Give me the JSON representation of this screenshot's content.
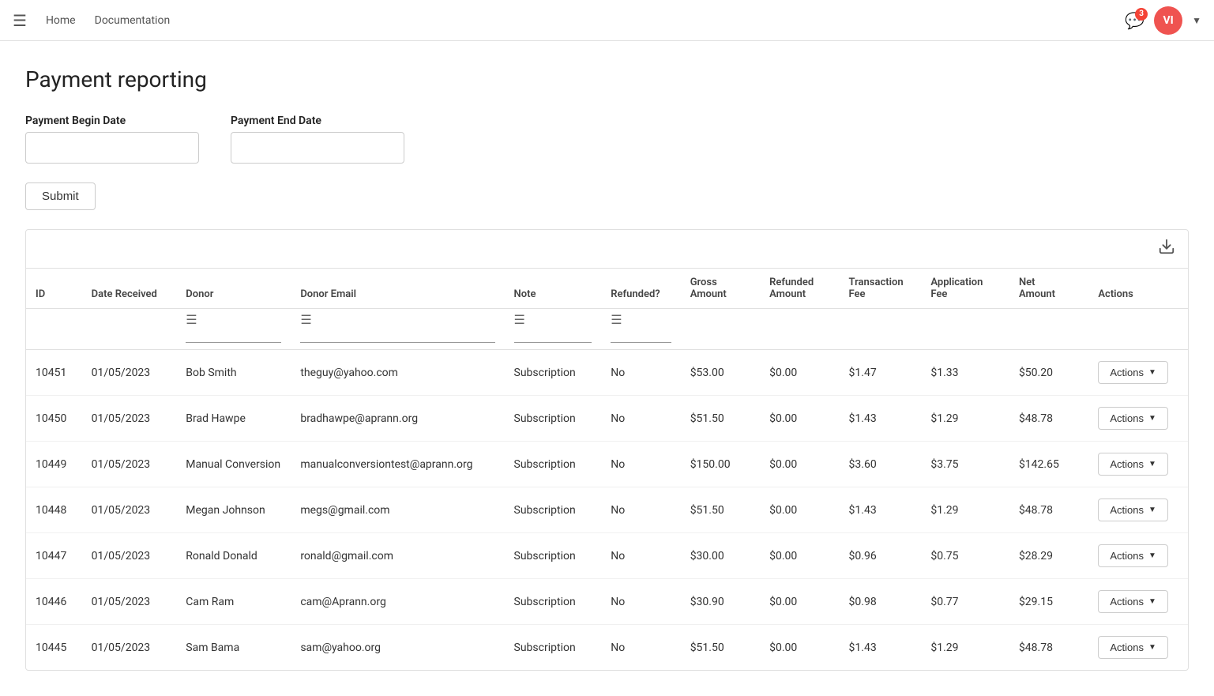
{
  "navbar": {
    "home_label": "Home",
    "documentation_label": "Documentation",
    "notification_count": "3",
    "avatar_initials": "VI"
  },
  "page": {
    "title": "Payment reporting"
  },
  "form": {
    "begin_date_label": "Payment Begin Date",
    "end_date_label": "Payment End Date",
    "begin_date_placeholder": "",
    "end_date_placeholder": "",
    "submit_label": "Submit"
  },
  "table": {
    "download_tooltip": "Download",
    "columns": {
      "id": "ID",
      "date_received": "Date Received",
      "donor": "Donor",
      "donor_email": "Donor Email",
      "note": "Note",
      "refunded": "Refunded?",
      "gross_amount": "Gross Amount",
      "refunded_amount": "Refunded Amount",
      "transaction_fee": "Transaction Fee",
      "application_fee": "Application Fee",
      "net_amount": "Net Amount",
      "actions": "Actions"
    },
    "rows": [
      {
        "id": "10451",
        "date": "01/05/2023",
        "donor": "Bob Smith",
        "email": "theguy@yahoo.com",
        "note": "Subscription",
        "refunded": "No",
        "gross": "$53.00",
        "refunded_amt": "$0.00",
        "tx_fee": "$1.47",
        "app_fee": "$1.33",
        "net": "$50.20"
      },
      {
        "id": "10450",
        "date": "01/05/2023",
        "donor": "Brad Hawpe",
        "email": "bradhawpe@aprann.org",
        "note": "Subscription",
        "refunded": "No",
        "gross": "$51.50",
        "refunded_amt": "$0.00",
        "tx_fee": "$1.43",
        "app_fee": "$1.29",
        "net": "$48.78"
      },
      {
        "id": "10449",
        "date": "01/05/2023",
        "donor": "Manual Conversion",
        "email": "manualconversiontest@aprann.org",
        "note": "Subscription",
        "refunded": "No",
        "gross": "$150.00",
        "refunded_amt": "$0.00",
        "tx_fee": "$3.60",
        "app_fee": "$3.75",
        "net": "$142.65"
      },
      {
        "id": "10448",
        "date": "01/05/2023",
        "donor": "Megan Johnson",
        "email": "megs@gmail.com",
        "note": "Subscription",
        "refunded": "No",
        "gross": "$51.50",
        "refunded_amt": "$0.00",
        "tx_fee": "$1.43",
        "app_fee": "$1.29",
        "net": "$48.78"
      },
      {
        "id": "10447",
        "date": "01/05/2023",
        "donor": "Ronald Donald",
        "email": "ronald@gmail.com",
        "note": "Subscription",
        "refunded": "No",
        "gross": "$30.00",
        "refunded_amt": "$0.00",
        "tx_fee": "$0.96",
        "app_fee": "$0.75",
        "net": "$28.29"
      },
      {
        "id": "10446",
        "date": "01/05/2023",
        "donor": "Cam Ram",
        "email": "cam@Aprann.org",
        "note": "Subscription",
        "refunded": "No",
        "gross": "$30.90",
        "refunded_amt": "$0.00",
        "tx_fee": "$0.98",
        "app_fee": "$0.77",
        "net": "$29.15"
      },
      {
        "id": "10445",
        "date": "01/05/2023",
        "donor": "Sam Bama",
        "email": "sam@yahoo.org",
        "note": "Subscription",
        "refunded": "No",
        "gross": "$51.50",
        "refunded_amt": "$0.00",
        "tx_fee": "$1.43",
        "app_fee": "$1.29",
        "net": "$48.78"
      }
    ],
    "actions_label": "Actions"
  }
}
